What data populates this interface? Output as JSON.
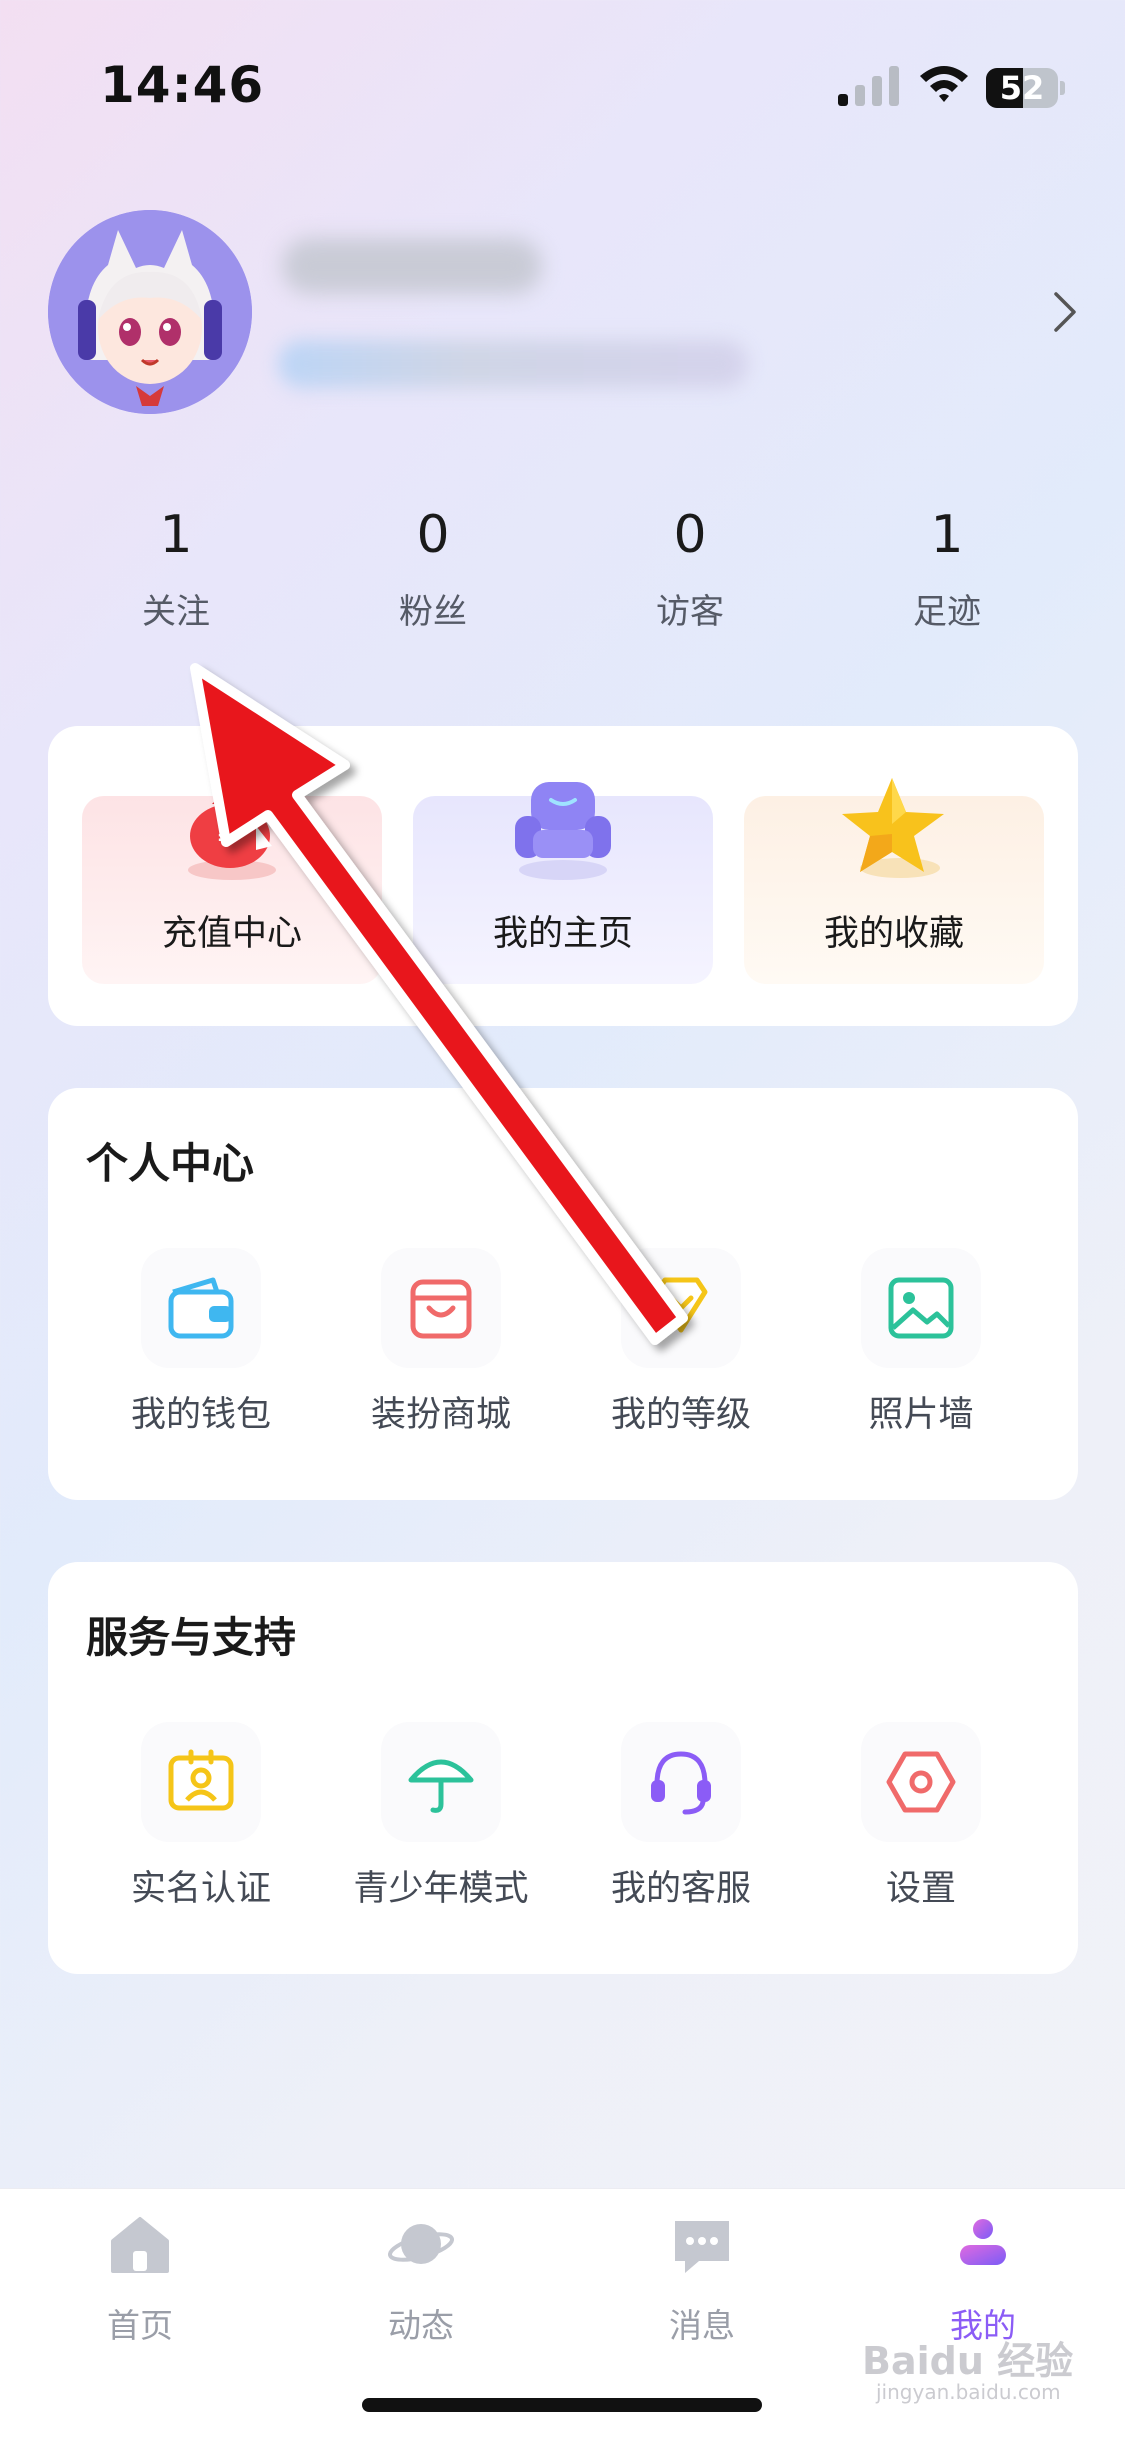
{
  "status_bar": {
    "time": "14:46",
    "battery": "52",
    "battery_level": 0.52
  },
  "profile": {
    "avatar": "avatar-image"
  },
  "stats": [
    {
      "value": "1",
      "label": "关注"
    },
    {
      "value": "0",
      "label": "粉丝"
    },
    {
      "value": "0",
      "label": "访客"
    },
    {
      "value": "1",
      "label": "足迹"
    }
  ],
  "features": [
    {
      "label": "充值中心",
      "icon": "money-bag-icon",
      "color": "#f04a4a"
    },
    {
      "label": "我的主页",
      "icon": "sofa-icon",
      "color": "#7c6cf0"
    },
    {
      "label": "我的收藏",
      "icon": "star-icon",
      "color": "#f7c325"
    }
  ],
  "personal_center": {
    "title": "个人中心",
    "items": [
      {
        "label": "我的钱包",
        "icon": "wallet-icon",
        "color": "#3fb7f0"
      },
      {
        "label": "装扮商城",
        "icon": "shopping-bag-icon",
        "color": "#f06a6a"
      },
      {
        "label": "我的等级",
        "icon": "level-gem-icon",
        "color": "#f5c518"
      },
      {
        "label": "照片墙",
        "icon": "photo-icon",
        "color": "#2cc29a"
      }
    ]
  },
  "services": {
    "title": "服务与支持",
    "items": [
      {
        "label": "实名认证",
        "icon": "id-card-icon",
        "color": "#f5c518"
      },
      {
        "label": "青少年模式",
        "icon": "umbrella-icon",
        "color": "#2cc29a"
      },
      {
        "label": "我的客服",
        "icon": "headset-icon",
        "color": "#8b5cf6"
      },
      {
        "label": "设置",
        "icon": "settings-hex-icon",
        "color": "#f06a6a"
      }
    ]
  },
  "tabbar": [
    {
      "label": "首页",
      "icon": "home-icon",
      "active": false
    },
    {
      "label": "动态",
      "icon": "planet-icon",
      "active": false
    },
    {
      "label": "消息",
      "icon": "chat-icon",
      "active": false
    },
    {
      "label": "我的",
      "icon": "person-icon",
      "active": true
    }
  ],
  "accent_color": "#8b5cf6",
  "watermark": {
    "text": "Baidu 经验",
    "sub": "jingyan.baidu.com"
  }
}
